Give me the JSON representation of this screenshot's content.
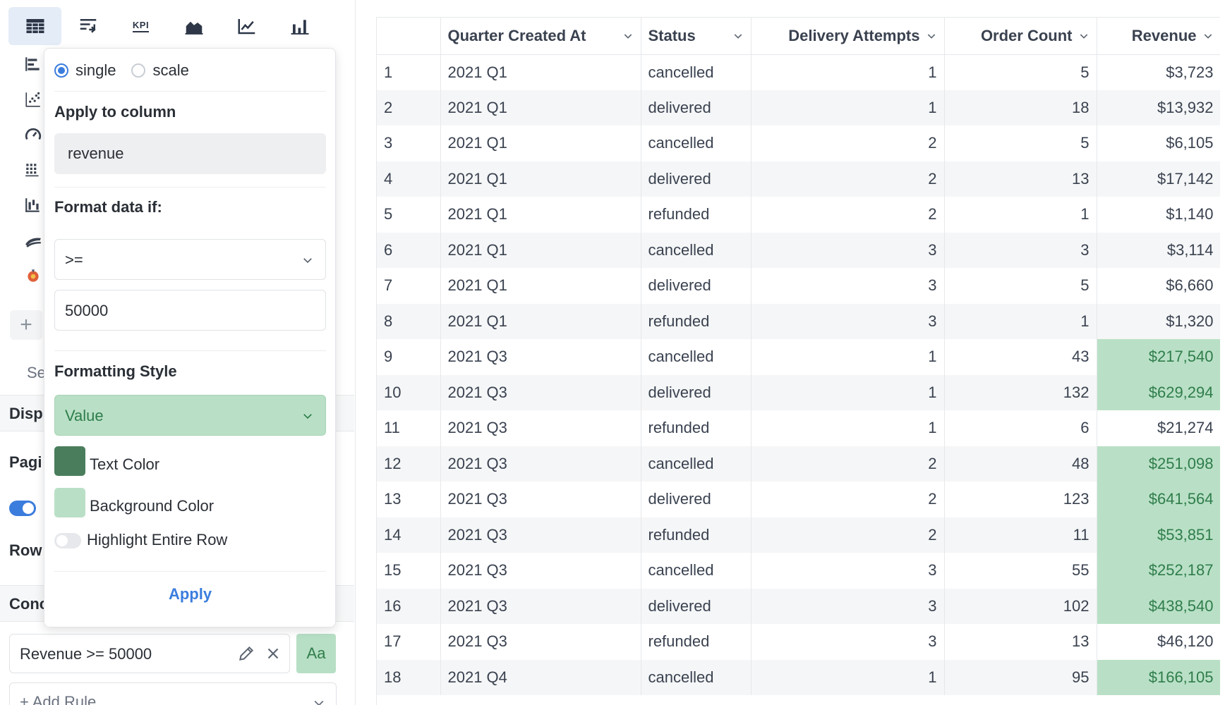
{
  "toolbar": {
    "buttons": [
      {
        "name": "table-chart-button",
        "icon": "table-icon",
        "active": true
      },
      {
        "name": "pivot-table-button",
        "icon": "pivot-table-icon"
      },
      {
        "name": "kpi-chart-button",
        "icon": "kpi-icon",
        "label": "KPI"
      },
      {
        "name": "area-chart-button",
        "icon": "area-chart-icon"
      },
      {
        "name": "line-chart-button",
        "icon": "line-chart-icon"
      },
      {
        "name": "bar-chart-button",
        "icon": "bar-chart-icon"
      }
    ]
  },
  "sidebar": {
    "section_se": "Se",
    "display_section": "Disp",
    "pagination_label": "Pagi",
    "row_label": "Row",
    "conditional_section": "Conc",
    "rule": {
      "text": "Revenue >= 50000",
      "style_label": "Aa"
    },
    "add_rule": "+ Add Rule..."
  },
  "popover": {
    "mode_options": [
      {
        "label": "single",
        "checked": true
      },
      {
        "label": "scale",
        "checked": false
      }
    ],
    "apply_to_column_label": "Apply to column",
    "column_value": "revenue",
    "format_if_label": "Format data if:",
    "operator": ">=",
    "threshold": "50000",
    "formatting_style_label": "Formatting Style",
    "style_value": "Value",
    "text_color_label": "Text Color",
    "text_color": "#4a7d5c",
    "background_color_label": "Background Color",
    "background_color": "#b9e0c6",
    "highlight_row_label": "Highlight Entire Row",
    "highlight_row_on": false,
    "apply_label": "Apply"
  },
  "table": {
    "columns": [
      "",
      "Quarter Created At",
      "Status",
      "Delivery Attempts",
      "Order Count",
      "Revenue"
    ],
    "highlight_color": "#b9e0c6",
    "highlight_text_color": "#2f7d4b",
    "rows": [
      {
        "n": "1",
        "quarter": "2021 Q1",
        "status": "cancelled",
        "attempts": "1",
        "orders": "5",
        "revenue": "$3,723",
        "hl": false
      },
      {
        "n": "2",
        "quarter": "2021 Q1",
        "status": "delivered",
        "attempts": "1",
        "orders": "18",
        "revenue": "$13,932",
        "hl": false
      },
      {
        "n": "3",
        "quarter": "2021 Q1",
        "status": "cancelled",
        "attempts": "2",
        "orders": "5",
        "revenue": "$6,105",
        "hl": false
      },
      {
        "n": "4",
        "quarter": "2021 Q1",
        "status": "delivered",
        "attempts": "2",
        "orders": "13",
        "revenue": "$17,142",
        "hl": false
      },
      {
        "n": "5",
        "quarter": "2021 Q1",
        "status": "refunded",
        "attempts": "2",
        "orders": "1",
        "revenue": "$1,140",
        "hl": false
      },
      {
        "n": "6",
        "quarter": "2021 Q1",
        "status": "cancelled",
        "attempts": "3",
        "orders": "3",
        "revenue": "$3,114",
        "hl": false
      },
      {
        "n": "7",
        "quarter": "2021 Q1",
        "status": "delivered",
        "attempts": "3",
        "orders": "5",
        "revenue": "$6,660",
        "hl": false
      },
      {
        "n": "8",
        "quarter": "2021 Q1",
        "status": "refunded",
        "attempts": "3",
        "orders": "1",
        "revenue": "$1,320",
        "hl": false
      },
      {
        "n": "9",
        "quarter": "2021 Q3",
        "status": "cancelled",
        "attempts": "1",
        "orders": "43",
        "revenue": "$217,540",
        "hl": true
      },
      {
        "n": "10",
        "quarter": "2021 Q3",
        "status": "delivered",
        "attempts": "1",
        "orders": "132",
        "revenue": "$629,294",
        "hl": true
      },
      {
        "n": "11",
        "quarter": "2021 Q3",
        "status": "refunded",
        "attempts": "1",
        "orders": "6",
        "revenue": "$21,274",
        "hl": false
      },
      {
        "n": "12",
        "quarter": "2021 Q3",
        "status": "cancelled",
        "attempts": "2",
        "orders": "48",
        "revenue": "$251,098",
        "hl": true
      },
      {
        "n": "13",
        "quarter": "2021 Q3",
        "status": "delivered",
        "attempts": "2",
        "orders": "123",
        "revenue": "$641,564",
        "hl": true
      },
      {
        "n": "14",
        "quarter": "2021 Q3",
        "status": "refunded",
        "attempts": "2",
        "orders": "11",
        "revenue": "$53,851",
        "hl": true
      },
      {
        "n": "15",
        "quarter": "2021 Q3",
        "status": "cancelled",
        "attempts": "3",
        "orders": "55",
        "revenue": "$252,187",
        "hl": true
      },
      {
        "n": "16",
        "quarter": "2021 Q3",
        "status": "delivered",
        "attempts": "3",
        "orders": "102",
        "revenue": "$438,540",
        "hl": true
      },
      {
        "n": "17",
        "quarter": "2021 Q3",
        "status": "refunded",
        "attempts": "3",
        "orders": "13",
        "revenue": "$46,120",
        "hl": false
      },
      {
        "n": "18",
        "quarter": "2021 Q4",
        "status": "cancelled",
        "attempts": "1",
        "orders": "95",
        "revenue": "$166,105",
        "hl": true
      }
    ]
  }
}
